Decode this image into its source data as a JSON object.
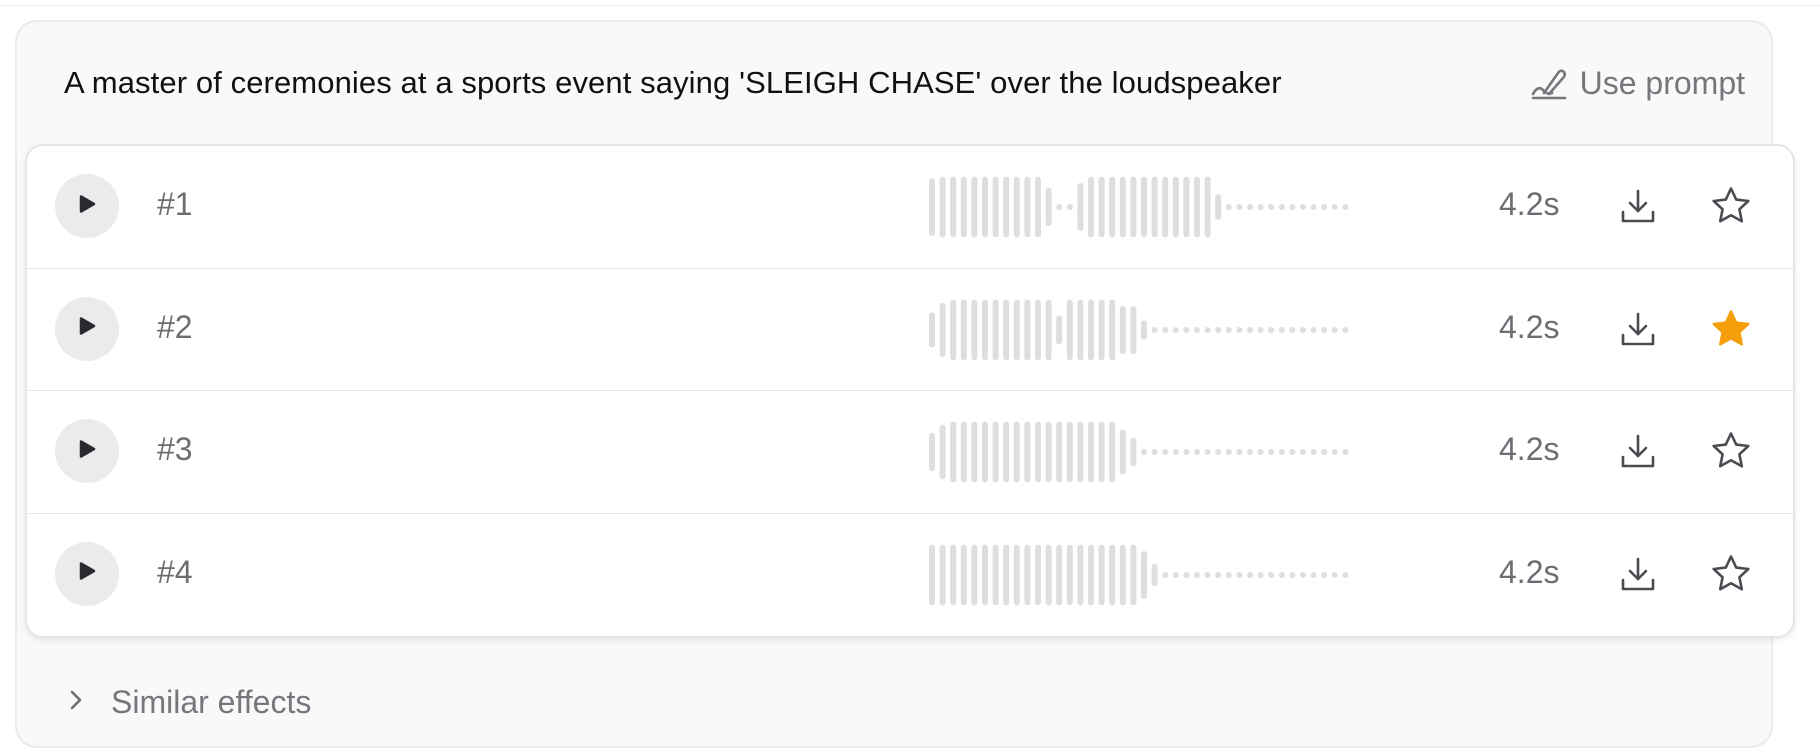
{
  "prompt": {
    "title": "A master of ceremonies at a sports event saying 'SLEIGH CHASE' over the loudspeaker",
    "use_prompt_label": "Use prompt",
    "use_prompt_icon": "pen-icon"
  },
  "colors": {
    "star_active": "#f59e0b",
    "waveform": "#dedede",
    "muted_text": "#6d6d73"
  },
  "samples": [
    {
      "label": "#1",
      "duration": "4.2s",
      "favorited": false,
      "waveform": [
        0.9,
        0.95,
        0.95,
        0.95,
        0.95,
        0.95,
        0.95,
        0.95,
        0.95,
        0.95,
        0.95,
        0.6,
        0,
        0,
        0.75,
        0.95,
        0.95,
        0.95,
        0.95,
        0.95,
        0.95,
        0.95,
        0.95,
        0.95,
        0.95,
        0.95,
        0.95,
        0.4,
        0,
        0,
        0,
        0,
        0,
        0,
        0,
        0,
        0,
        0,
        0,
        0
      ]
    },
    {
      "label": "#2",
      "duration": "4.2s",
      "favorited": true,
      "waveform": [
        0.55,
        0.85,
        0.95,
        0.95,
        0.95,
        0.95,
        0.95,
        0.95,
        0.95,
        0.95,
        0.95,
        0.95,
        0.45,
        0.95,
        0.95,
        0.95,
        0.95,
        0.95,
        0.75,
        0.75,
        0.3,
        0,
        0,
        0,
        0,
        0,
        0,
        0,
        0,
        0,
        0,
        0,
        0,
        0,
        0,
        0,
        0,
        0,
        0,
        0
      ]
    },
    {
      "label": "#3",
      "duration": "4.2s",
      "favorited": false,
      "waveform": [
        0.6,
        0.85,
        0.95,
        0.95,
        0.95,
        0.95,
        0.95,
        0.95,
        0.95,
        0.95,
        0.95,
        0.95,
        0.95,
        0.95,
        0.95,
        0.95,
        0.95,
        0.95,
        0.7,
        0.45,
        0,
        0,
        0,
        0,
        0,
        0,
        0,
        0,
        0,
        0,
        0,
        0,
        0,
        0,
        0,
        0,
        0,
        0,
        0,
        0
      ]
    },
    {
      "label": "#4",
      "duration": "4.2s",
      "favorited": false,
      "waveform": [
        0.95,
        0.95,
        0.95,
        0.95,
        0.95,
        0.95,
        0.95,
        0.95,
        0.95,
        0.95,
        0.95,
        0.95,
        0.95,
        0.95,
        0.95,
        0.95,
        0.95,
        0.95,
        0.95,
        0.95,
        0.75,
        0.35,
        0,
        0,
        0,
        0,
        0,
        0,
        0,
        0,
        0,
        0,
        0,
        0,
        0,
        0,
        0,
        0,
        0,
        0
      ]
    }
  ],
  "similar": {
    "label": "Similar effects",
    "icon": "chevron-right-icon"
  }
}
